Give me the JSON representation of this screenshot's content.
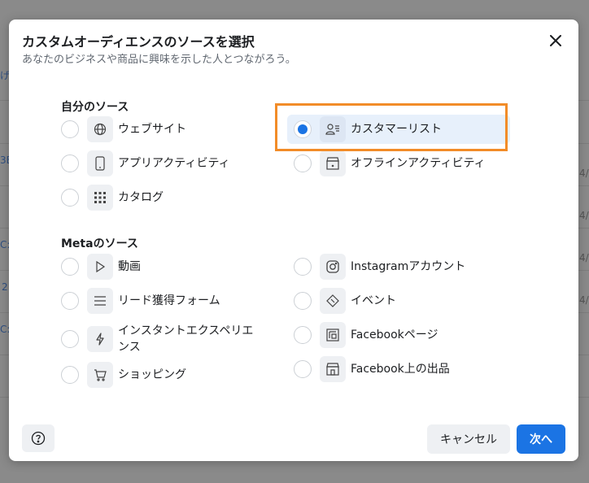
{
  "background": {
    "fragments": [
      "げ言",
      "3B",
      "C:",
      "2",
      "C:",
      "4/",
      "4/",
      "4/",
      "4/"
    ]
  },
  "modal": {
    "title": "カスタムオーディエンスのソースを選択",
    "subtitle": "あなたのビジネスや商品に興味を示した人とつながろう。",
    "close_icon": "close-icon"
  },
  "own_sources": {
    "heading": "自分のソース",
    "options": [
      {
        "label": "ウェブサイト",
        "icon": "globe-icon",
        "selected": false
      },
      {
        "label": "カスタマーリスト",
        "icon": "customer-list-icon",
        "selected": true
      },
      {
        "label": "アプリアクティビティ",
        "icon": "mobile-icon",
        "selected": false
      },
      {
        "label": "オフラインアクティビティ",
        "icon": "store-icon",
        "selected": false
      },
      {
        "label": "カタログ",
        "icon": "grid-icon",
        "selected": false
      }
    ]
  },
  "meta_sources": {
    "heading": "Metaのソース",
    "options": [
      {
        "label": "動画",
        "icon": "play-icon",
        "selected": false
      },
      {
        "label": "Instagramアカウント",
        "icon": "instagram-icon",
        "selected": false
      },
      {
        "label": "リード獲得フォーム",
        "icon": "lines-icon",
        "selected": false
      },
      {
        "label": "イベント",
        "icon": "ticket-icon",
        "selected": false
      },
      {
        "label": "インスタントエクスペリエンス",
        "icon": "lightning-icon",
        "selected": false
      },
      {
        "label": "Facebookページ",
        "icon": "page-icon",
        "selected": false
      },
      {
        "label": "ショッピング",
        "icon": "cart-icon",
        "selected": false
      },
      {
        "label": "Facebook上の出品",
        "icon": "shop-icon",
        "selected": false
      }
    ]
  },
  "footer": {
    "help_icon": "question-icon",
    "cancel_label": "キャンセル",
    "next_label": "次へ"
  },
  "colors": {
    "accent": "#1b74e4",
    "highlight": "#f28c28",
    "selected_bg": "#e7f0fb"
  }
}
